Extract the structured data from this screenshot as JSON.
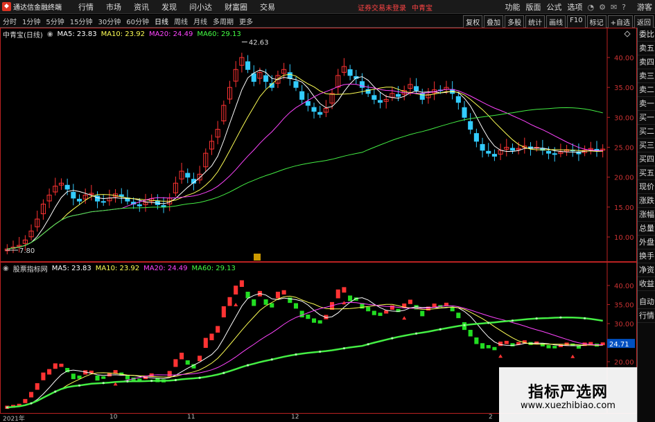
{
  "menubar": {
    "app_title": "通达信金融终端",
    "items": [
      "行情",
      "市场",
      "资讯",
      "发现",
      "问小达",
      "财富圈",
      "交易"
    ],
    "notice": "证券交易未登录",
    "stock": "中青宝",
    "right_items": [
      "功能",
      "版面",
      "公式",
      "选项"
    ],
    "user": "游客"
  },
  "toolbar": {
    "periods": [
      "分时",
      "1分钟",
      "5分钟",
      "15分钟",
      "30分钟",
      "60分钟",
      "日线",
      "周线",
      "月线",
      "多周期",
      "更多"
    ],
    "active_period": "日线",
    "right_tools": [
      "复权",
      "叠加",
      "多股",
      "统计",
      "画线",
      "F10",
      "标记",
      "+自选",
      "返回"
    ]
  },
  "main_chart": {
    "title": "中青宝(日线)",
    "ma_labels": [
      "MA5: 23.83",
      "MA10: 23.92",
      "MA20: 24.49",
      "MA60: 29.13"
    ],
    "ma_colors": [
      "#ffffff",
      "#ffff55",
      "#ff44ff",
      "#44ff44"
    ],
    "high_label": "42.63",
    "low_label": "7.80",
    "y_ticks": [
      "40.00",
      "35.00",
      "30.00",
      "25.00",
      "20.00",
      "15.00",
      "10.00"
    ],
    "y_values": [
      40,
      35,
      30,
      25,
      20,
      15,
      10
    ]
  },
  "indicator_chart": {
    "title": "股票指标网",
    "ma_labels": [
      "MA5: 23.83",
      "MA10: 23.92",
      "MA20: 24.49",
      "MA60: 29.13"
    ],
    "y_ticks": [
      "40.00",
      "35.00",
      "30.00",
      "25.00",
      "20.00"
    ],
    "y_values": [
      40,
      35,
      30,
      25,
      20
    ],
    "current_price": "24.71"
  },
  "date_axis": [
    "2021年",
    "10",
    "11",
    "12",
    "2"
  ],
  "side_panel": [
    "委比",
    "卖五",
    "卖四",
    "卖三",
    "卖二",
    "卖一",
    "买一",
    "买二",
    "买三",
    "买四",
    "买五",
    "现价",
    "涨跌",
    "涨幅",
    "总量",
    "外盘",
    "换手",
    "净资",
    "收益",
    "自动",
    "行情"
  ],
  "watermark": {
    "title": "指标严选网",
    "url": "www.xuezhibiao.com"
  },
  "colors": {
    "up": "#ff3333",
    "down": "#33ccff",
    "ind_down": "#22dd22",
    "ma60": "#44ee44",
    "axis": "#b22"
  },
  "chart_data": {
    "type": "candlestick",
    "title": "中青宝(日线)",
    "xlabel": "",
    "ylabel": "",
    "ylim": [
      7,
      44
    ],
    "annotations": [
      "42.63",
      "7.80"
    ],
    "closes": [
      8.0,
      8.3,
      8.6,
      9.5,
      11,
      13,
      15.5,
      17,
      18.5,
      19,
      18,
      16.5,
      16,
      17,
      17.3,
      16,
      15.8,
      16.5,
      17.2,
      16.8,
      16,
      15.5,
      15.2,
      15.8,
      16.4,
      15.4,
      15.0,
      16.5,
      19,
      21,
      20,
      19,
      20.5,
      24,
      26,
      28,
      32,
      35,
      38,
      40,
      38,
      36,
      37.5,
      36,
      35,
      37,
      38,
      36.5,
      35,
      33,
      32,
      31,
      30.5,
      31.5,
      34,
      37,
      38.5,
      37,
      36.5,
      35,
      34,
      33,
      32.5,
      33,
      34,
      33.5,
      34.5,
      35.5,
      34.5,
      33,
      33.8,
      34.6,
      34.5,
      35,
      34,
      32.5,
      30,
      28,
      26,
      24.5,
      24,
      23.5,
      24.5,
      25,
      24.5,
      24.8,
      25.2,
      24.8,
      25,
      24.5,
      24.0,
      23.8,
      24.2,
      24.6,
      24.4,
      23.9,
      24.5,
      24.8,
      24.4,
      24.7
    ],
    "ma5_last": 23.83,
    "ma10_last": 23.92,
    "ma20_last": 24.49,
    "ma60_last": 29.13
  }
}
